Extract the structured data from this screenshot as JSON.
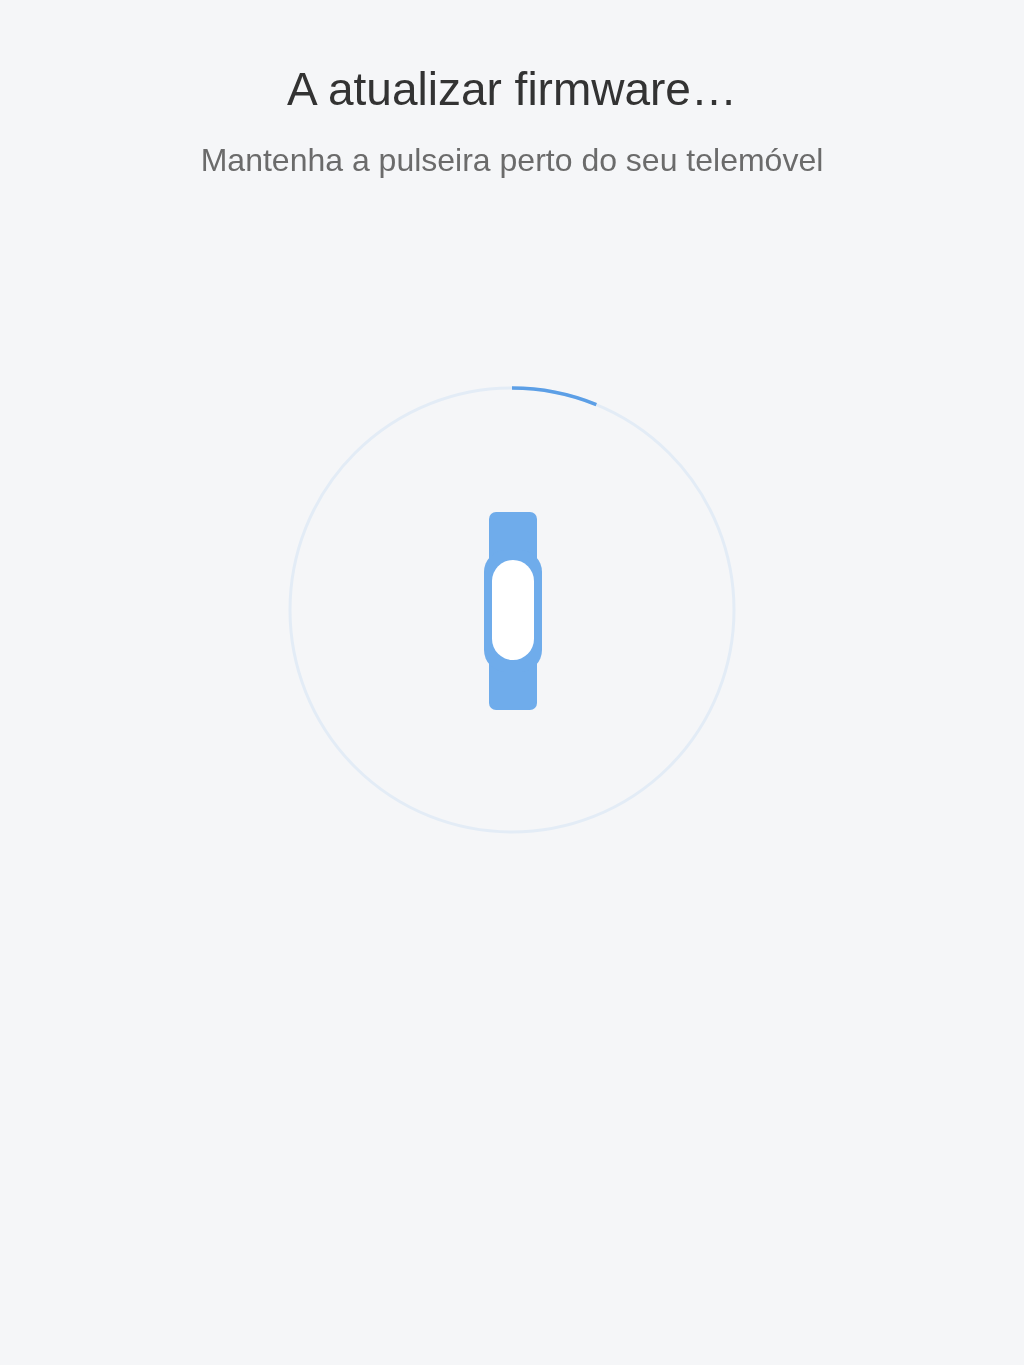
{
  "title": "A atualizar firmware…",
  "subtitle": "Mantenha a pulseira perto do seu telemóvel"
}
